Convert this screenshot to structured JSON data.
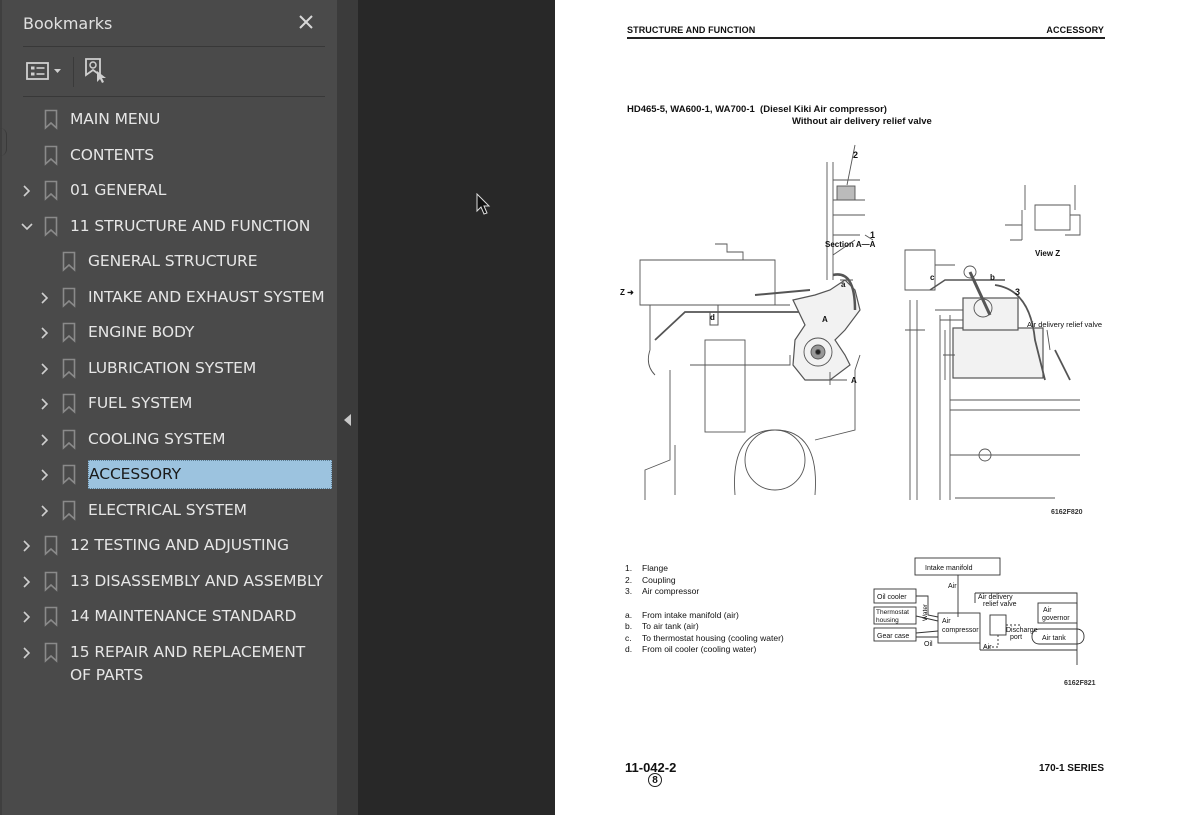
{
  "sidebar": {
    "title": "Bookmarks",
    "close_icon": "close-icon",
    "toolbar": {
      "options_icon": "list-options-icon",
      "find_bookmark_icon": "find-current-bookmark-icon"
    },
    "items": [
      {
        "label": "MAIN MENU",
        "level": 0,
        "expander": "none"
      },
      {
        "label": "CONTENTS",
        "level": 0,
        "expander": "none"
      },
      {
        "label": "01 GENERAL",
        "level": 0,
        "expander": "collapsed"
      },
      {
        "label": "11 STRUCTURE AND FUNCTION",
        "level": 0,
        "expander": "expanded"
      },
      {
        "label": "GENERAL STRUCTURE",
        "level": 1,
        "expander": "none"
      },
      {
        "label": "INTAKE AND EXHAUST SYSTEM",
        "level": 1,
        "expander": "collapsed"
      },
      {
        "label": "ENGINE BODY",
        "level": 1,
        "expander": "collapsed"
      },
      {
        "label": "LUBRICATION SYSTEM",
        "level": 1,
        "expander": "collapsed"
      },
      {
        "label": "FUEL SYSTEM",
        "level": 1,
        "expander": "collapsed"
      },
      {
        "label": "COOLING SYSTEM",
        "level": 1,
        "expander": "collapsed"
      },
      {
        "label": "ACCESSORY",
        "level": 1,
        "expander": "collapsed",
        "selected": true
      },
      {
        "label": "ELECTRICAL SYSTEM",
        "level": 1,
        "expander": "collapsed"
      },
      {
        "label": "12 TESTING AND ADJUSTING",
        "level": 0,
        "expander": "collapsed"
      },
      {
        "label": "13 DISASSEMBLY AND ASSEMBLY",
        "level": 0,
        "expander": "collapsed"
      },
      {
        "label": "14 MAINTENANCE STANDARD",
        "level": 0,
        "expander": "collapsed"
      },
      {
        "label": "15 REPAIR AND REPLACEMENT OF PARTS",
        "level": 0,
        "expander": "collapsed"
      }
    ]
  },
  "colors": {
    "sidebar_bg": "#4a4a4a",
    "canvas_bg": "#282828",
    "selected_bg": "#9cc3df",
    "text": "#e6e6e6"
  },
  "page": {
    "header_left": "STRUCTURE AND FUNCTION",
    "header_right": "ACCESSORY",
    "title_line1": "HD465-5, WA600-1, WA700-1  (Diesel Kiki Air compressor)",
    "title_line2": "Without air delivery relief valve",
    "drawing_labels": {
      "section": "Section A—A",
      "view": "View Z",
      "z_arrow": "Z ➜",
      "relief_valve": "Air delivery relief valve",
      "n1": "1",
      "n2": "2",
      "n3": "3",
      "a": "a",
      "b": "b",
      "c": "c",
      "d": "d",
      "A": "A"
    },
    "figure_code_1": "6162F820",
    "figure_code_2": "6162F821",
    "legend_numbers": [
      {
        "key": "1.",
        "text": "Flange"
      },
      {
        "key": "2.",
        "text": "Coupling"
      },
      {
        "key": "3.",
        "text": "Air compressor"
      }
    ],
    "legend_letters": [
      {
        "key": "a.",
        "text": "From intake manifold (air)"
      },
      {
        "key": "b.",
        "text": "To air tank (air)"
      },
      {
        "key": "c.",
        "text": "To thermostat housing (cooling water)"
      },
      {
        "key": "d.",
        "text": "From oil cooler (cooling water)"
      }
    ],
    "diagram": {
      "intake_manifold": "Intake manifold",
      "air_top": "Air",
      "oil_cooler": "Oil cooler",
      "thermostat_l1": "Thermostat",
      "thermostat_l2": "housing",
      "gear_case": "Gear case",
      "water": "Water",
      "oil": "Oil",
      "compressor_l1": "Air",
      "compressor_l2": "compressor",
      "relief_l1": "Air delivery",
      "relief_l2": "relief valve",
      "discharge_l1": "Discharge",
      "discharge_l2": "port",
      "governor_l1": "Air",
      "governor_l2": "governor",
      "air_tank": "Air tank",
      "air_bottom": "Air"
    },
    "footer_page": "11-042-2",
    "footer_revision": "8",
    "footer_series": "170-1 SERIES"
  }
}
